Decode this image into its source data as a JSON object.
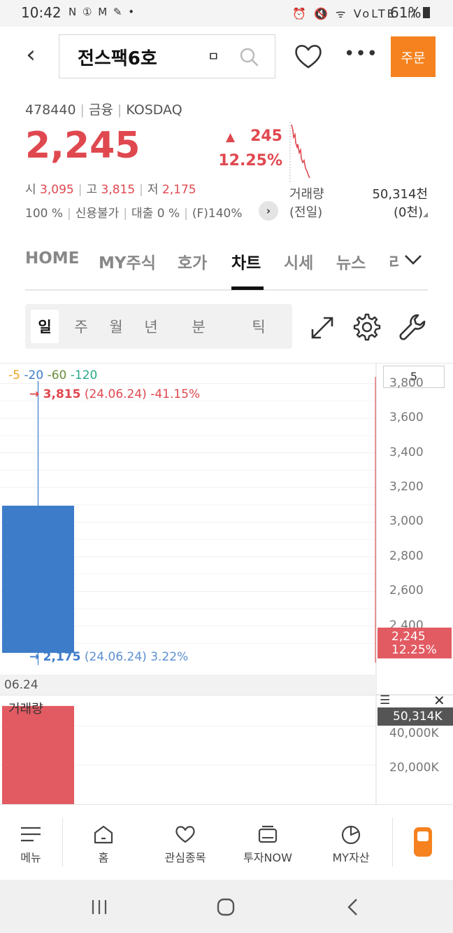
{
  "status_bar": {
    "time": "10:42",
    "left_icons": "N ① M ✎ •",
    "right_icons": "⏰ 🔇 ᯤ VoLTE .ıl",
    "battery": "61%"
  },
  "header": {
    "stock_name": "전스팩6호",
    "name_tag": "ㅁ",
    "order_label": "주문",
    "more_label": "•••"
  },
  "info": {
    "code": "478440",
    "sector": "금융",
    "market": "KOSDAQ",
    "price": "2,245",
    "change_arrow": "▲",
    "change": "245",
    "change_pct": "12.25%",
    "open_label": "시",
    "open": "3,095",
    "high_label": "고",
    "high": "3,815",
    "low_label": "저",
    "low": "2,175",
    "margin_rate": "100 %",
    "credit": "신용불가",
    "loan": "대출 0 %",
    "f_rate": "(F)140%",
    "detail_arrow": "›",
    "volume_label_1": "거래량",
    "volume_label_2": "(전일)",
    "volume_value": "50,314천",
    "volume_prev": "(0천)"
  },
  "tabs": {
    "items": [
      "HOME",
      "MY주식",
      "호가",
      "차트",
      "시세",
      "뉴스",
      "리"
    ],
    "active": "차트",
    "more_icon": "chevron-down-icon"
  },
  "periods": {
    "items": [
      "일",
      "주",
      "월",
      "년",
      "분",
      "틱"
    ],
    "active": "일"
  },
  "chart": {
    "ma_legend": [
      {
        "label": "5",
        "color": "#f0a020"
      },
      {
        "label": "20",
        "color": "#3d7cc9"
      },
      {
        "label": "60",
        "color": "#6b8e3a"
      },
      {
        "label": "120",
        "color": "#2aa88a"
      }
    ],
    "high_annotation": {
      "arrow": "→",
      "value": "3,815",
      "detail": "(24.06.24) -41.15%"
    },
    "low_annotation": {
      "arrow": "→",
      "value": "2,175",
      "detail": "(24.06.24) 3.22%"
    },
    "period_input": "5",
    "current_tag_price": "2,245",
    "current_tag_pct": "12.25%",
    "date_label": "06.24",
    "volume_title": "거래량",
    "volume_current": "50,314K",
    "volume_ticks": [
      "40,000K",
      "20,000K"
    ]
  },
  "chart_data": {
    "type": "candlestick",
    "candles": [
      {
        "date": "06.24",
        "open": 3095,
        "high": 3815,
        "low": 2175,
        "close": 2245,
        "volume_k": 50314
      }
    ],
    "y_ticks": [
      3800,
      3600,
      3400,
      3200,
      3000,
      2800,
      2600,
      2400
    ],
    "ylim": [
      2120,
      3920
    ],
    "volume_ylim": [
      0,
      56000
    ],
    "colors": {
      "down": "#3d7cc9",
      "up": "#e0484f",
      "volume": "#e25a62"
    }
  },
  "bottom_nav": [
    {
      "label": "메뉴",
      "icon": "menu-icon"
    },
    {
      "label": "홈",
      "icon": "home-icon"
    },
    {
      "label": "관심종목",
      "icon": "heart-icon"
    },
    {
      "label": "투자NOW",
      "icon": "news-icon"
    },
    {
      "label": "MY자산",
      "icon": "pie-chart-icon"
    },
    {
      "label": "",
      "icon": "phone-app-icon"
    }
  ],
  "colors": {
    "accent_orange": "#f5821f",
    "price_red": "#e0484f",
    "blue": "#3d7cc9"
  }
}
